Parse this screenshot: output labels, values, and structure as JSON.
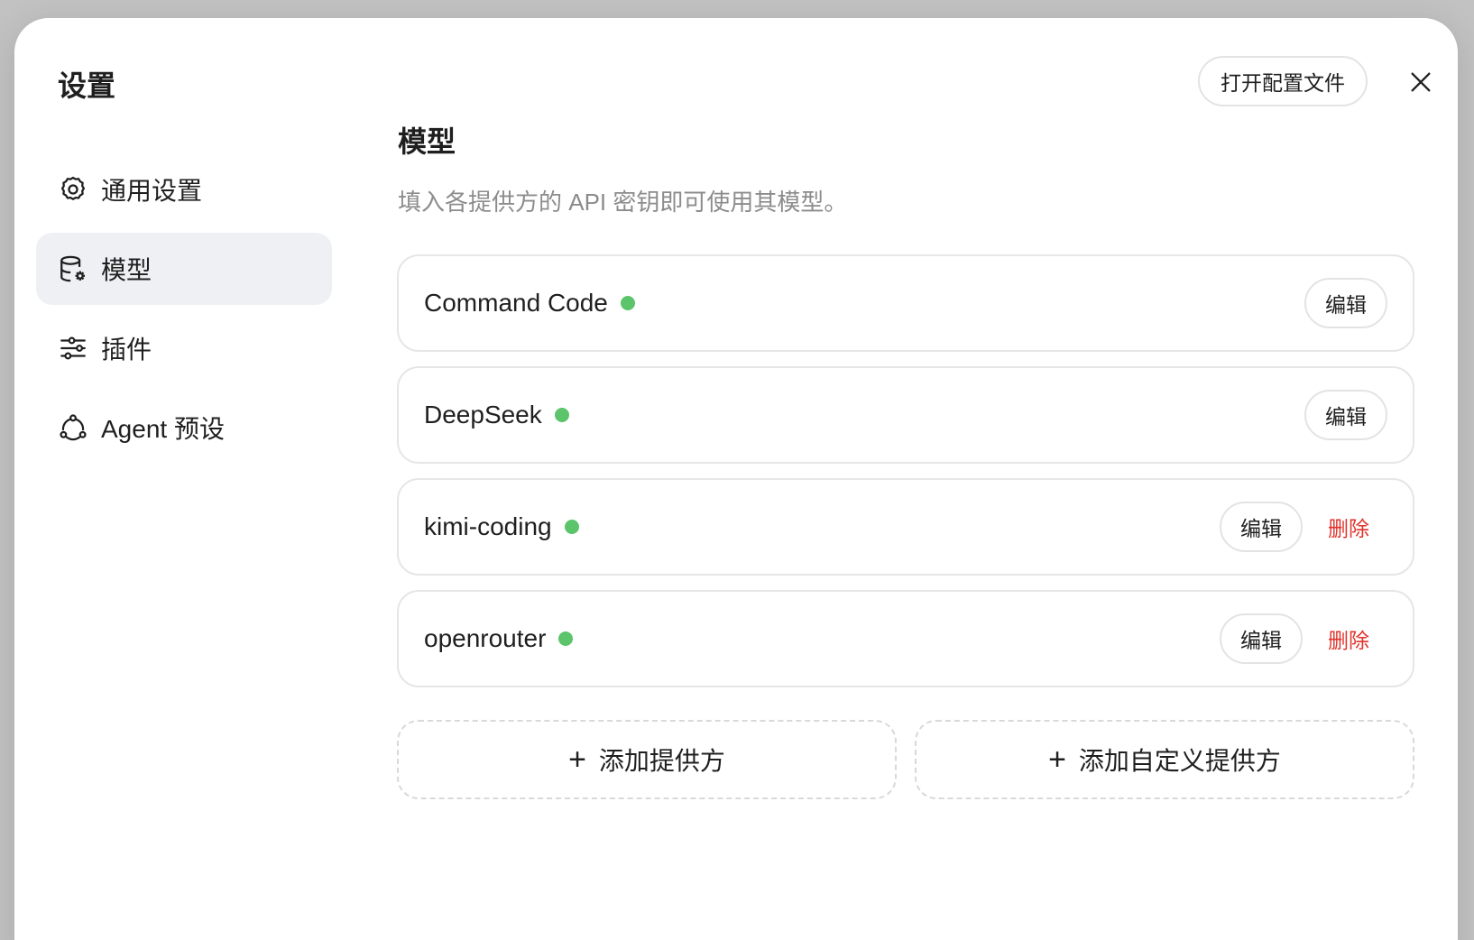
{
  "sidebar": {
    "title": "设置",
    "items": [
      {
        "label": "通用设置",
        "icon": "gear-icon",
        "active": false
      },
      {
        "label": "模型",
        "icon": "database-gear-icon",
        "active": true
      },
      {
        "label": "插件",
        "icon": "sliders-icon",
        "active": false
      },
      {
        "label": "Agent 预设",
        "icon": "agent-network-icon",
        "active": false
      }
    ]
  },
  "header": {
    "open_config_label": "打开配置文件",
    "close_icon": "close-icon"
  },
  "main": {
    "title": "模型",
    "description": "填入各提供方的 API 密钥即可使用其模型。",
    "providers": [
      {
        "name": "Command Code",
        "status": "active",
        "edit_label": "编辑",
        "delete_label": null
      },
      {
        "name": "DeepSeek",
        "status": "active",
        "edit_label": "编辑",
        "delete_label": null
      },
      {
        "name": "kimi-coding",
        "status": "active",
        "edit_label": "编辑",
        "delete_label": "删除"
      },
      {
        "name": "openrouter",
        "status": "active",
        "edit_label": "编辑",
        "delete_label": "删除"
      }
    ],
    "add_provider_label": "添加提供方",
    "add_custom_provider_label": "添加自定义提供方"
  },
  "colors": {
    "status_active": "#5cc46b",
    "delete_text": "#e0332b",
    "active_nav_bg": "#eef0f3"
  }
}
